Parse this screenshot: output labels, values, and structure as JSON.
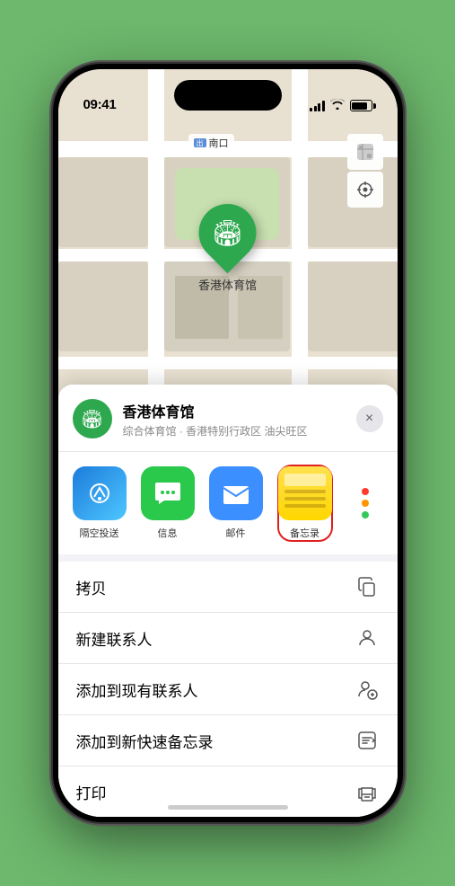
{
  "status_bar": {
    "time": "09:41",
    "location_icon": "▶"
  },
  "map": {
    "label_text": "南口",
    "location_name": "香港体育馆",
    "controls": {
      "map_icon": "🗺",
      "location_icon": "◎"
    }
  },
  "sheet": {
    "place_name": "香港体育馆",
    "place_subtitle": "综合体育馆 · 香港特别行政区 油尖旺区",
    "close_label": "×"
  },
  "share_apps": [
    {
      "id": "airdrop",
      "label": "隔空投送",
      "type": "airdrop"
    },
    {
      "id": "messages",
      "label": "信息",
      "type": "messages"
    },
    {
      "id": "mail",
      "label": "邮件",
      "type": "mail"
    },
    {
      "id": "notes",
      "label": "备忘录",
      "type": "notes",
      "selected": true
    }
  ],
  "actions": [
    {
      "id": "copy",
      "label": "拷贝",
      "icon": "copy"
    },
    {
      "id": "new-contact",
      "label": "新建联系人",
      "icon": "person"
    },
    {
      "id": "add-contact",
      "label": "添加到现有联系人",
      "icon": "person-add"
    },
    {
      "id": "add-notes",
      "label": "添加到新快速备忘录",
      "icon": "notes"
    },
    {
      "id": "print",
      "label": "打印",
      "icon": "printer"
    }
  ]
}
